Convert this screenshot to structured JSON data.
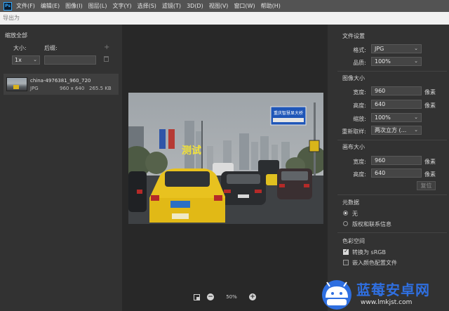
{
  "menubar": {
    "logo": "Ps",
    "items": [
      "文件(F)",
      "编辑(E)",
      "图像(I)",
      "图层(L)",
      "文字(Y)",
      "选择(S)",
      "滤镜(T)",
      "3D(D)",
      "视图(V)",
      "窗口(W)",
      "帮助(H)"
    ]
  },
  "dialog": {
    "title": "导出为"
  },
  "left_panel": {
    "heading": "缩放全部",
    "size_label": "大小:",
    "suffix_label": "后缀:",
    "scale_value": "1x",
    "add_icon": "+",
    "file": {
      "name": "china-4976381_960_720",
      "format": "JPG",
      "dimensions": "960 x 640",
      "size": "265.5 KB"
    }
  },
  "preview": {
    "overlay_text": "测试",
    "sign_text": "重庆智慧显大桥",
    "zoom": "50%"
  },
  "right_panel": {
    "file_settings": {
      "title": "文件设置",
      "format_label": "格式:",
      "format_value": "JPG",
      "quality_label": "品质:",
      "quality_value": "100%"
    },
    "image_size": {
      "title": "图像大小",
      "width_label": "宽度:",
      "width_value": "960",
      "height_label": "高度:",
      "height_value": "640",
      "scale_label": "缩放:",
      "scale_value": "100%",
      "resample_label": "重新取样:",
      "resample_value": "两次立方 (...",
      "unit": "像素"
    },
    "canvas_size": {
      "title": "画布大小",
      "width_label": "宽度:",
      "width_value": "960",
      "height_label": "高度:",
      "height_value": "640",
      "unit": "像素",
      "reset_label": "复位"
    },
    "metadata": {
      "title": "元数据",
      "options": [
        "无",
        "版权和联系信息"
      ],
      "selected": "无"
    },
    "color_space": {
      "title": "色彩空间",
      "convert_label": "转换为 sRGB",
      "convert_checked": true,
      "embed_label": "嵌入颜色配置文件",
      "embed_checked": false
    }
  },
  "watermark": {
    "brand": "蓝莓安卓网",
    "url": "www.lmkjst.com"
  },
  "colors": {
    "menubar": "#535353",
    "panel": "#323232",
    "canvas": "#282828",
    "taxi_yellow": "#e8c21f",
    "overlay_text": "#f2e23a",
    "sign_blue": "#1f56b8",
    "watermark_blue": "#2f6fe0"
  }
}
